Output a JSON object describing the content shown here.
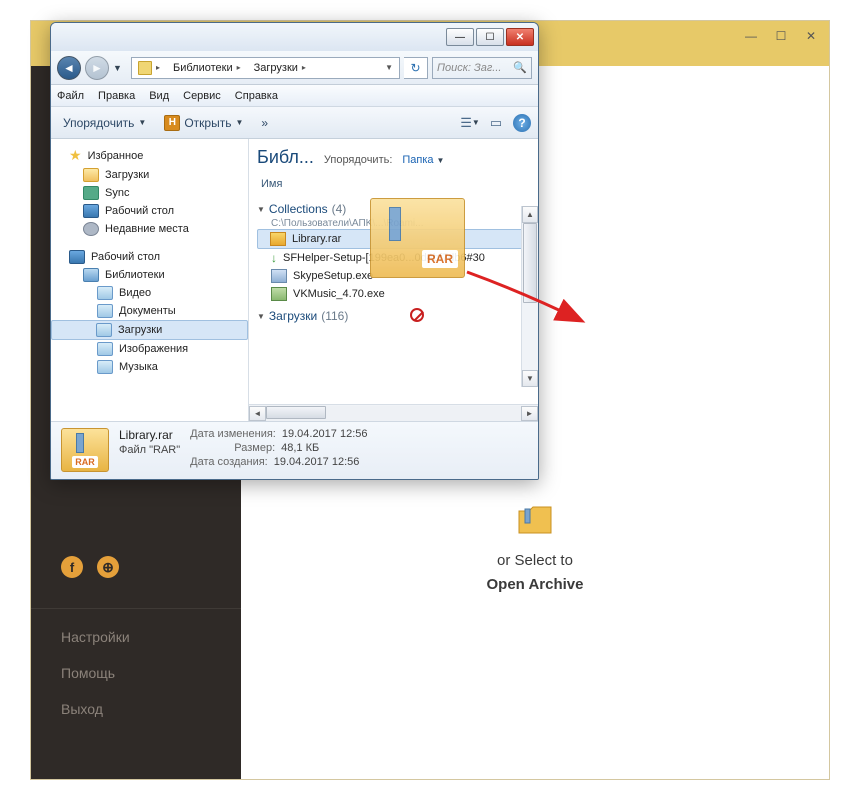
{
  "bg": {
    "controls": {
      "min": "—",
      "max": "☐",
      "close": "✕"
    },
    "drop_text_partial": "or Select to",
    "drop_text_line2": "Open Archive",
    "links": {
      "settings": "Настройки",
      "help": "Помощь",
      "exit": "Выход"
    }
  },
  "explorer": {
    "win": {
      "min": "—",
      "max": "☐",
      "close": "✕"
    },
    "breadcrumb": {
      "libraries": "Библиотеки",
      "downloads": "Загрузки"
    },
    "addr_dd": "▼",
    "refresh": "↻",
    "search_placeholder": "Поиск: Заг...",
    "menu": {
      "file": "Файл",
      "edit": "Правка",
      "view": "Вид",
      "tools": "Сервис",
      "help": "Справка"
    },
    "toolbar": {
      "organize": "Упорядочить",
      "open_badge": "H",
      "open": "Открыть",
      "more": "»",
      "view_tri": "▼"
    },
    "tree": {
      "favorites": "Избранное",
      "downloads": "Загрузки",
      "sync": "Sync",
      "desktop": "Рабочий стол",
      "recent": "Недавние места",
      "desktop2": "Рабочий стол",
      "libraries": "Библиотеки",
      "video": "Видео",
      "documents": "Документы",
      "downloads2": "Загрузки",
      "images": "Изображения",
      "music": "Музыка"
    },
    "content": {
      "lib_title": "Библ...",
      "sort_lbl": "Упорядочить:",
      "sort_val": "Папка",
      "col_name": "Имя",
      "groups": [
        {
          "name": "Collections",
          "count": "(4)",
          "path": "C:\\Пользователи\\AПK\\...\\Roami...",
          "files": [
            {
              "icon": "rar",
              "name": "Library.rar",
              "selected": true
            },
            {
              "icon": "dl",
              "name": "SFHelper-Setup-[199ea0...0d4bf7db6#30"
            },
            {
              "icon": "exe",
              "name": "SkypeSetup.exe"
            },
            {
              "icon": "inst",
              "name": "VKMusic_4.70.exe"
            }
          ]
        },
        {
          "name": "Загрузки",
          "count": "(116)"
        }
      ]
    },
    "details": {
      "name": "Library.rar",
      "type": "Файл \"RAR\"",
      "rows": [
        {
          "label": "Дата изменения:",
          "value": "19.04.2017 12:56"
        },
        {
          "label": "Размер:",
          "value": "48,1 КБ"
        },
        {
          "label": "Дата создания:",
          "value": "19.04.2017 12:56"
        }
      ],
      "rar_tag": "RAR"
    },
    "drag_rar": "RAR"
  }
}
